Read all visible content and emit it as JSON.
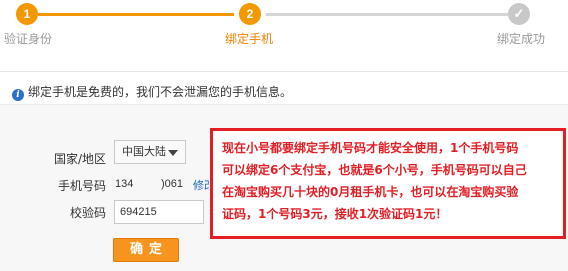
{
  "steps": [
    {
      "number": "1",
      "label": "验证身份",
      "state": "done"
    },
    {
      "number": "2",
      "label": "绑定手机",
      "state": "current"
    },
    {
      "number": "✓",
      "label": "绑定成功",
      "state": "pending"
    }
  ],
  "colors": {
    "accent": "#f39800",
    "link": "#1a66c2",
    "annotation": "#e31e24",
    "inactive": "#c8c8c8"
  },
  "notice": {
    "icon": "info-icon",
    "text": "绑定手机是免费的，我们不会泄漏您的手机信息。"
  },
  "form": {
    "country_label": "国家/地区",
    "country_value": "中国大陆",
    "phone_label": "手机号码",
    "phone_prefix": "134",
    "phone_suffix": ")061",
    "modify_link": "修改",
    "code_label": "校验码",
    "code_value": "694215",
    "confirm_button": "确定"
  },
  "annotation": {
    "lines": [
      "现在小号都要绑定手机号码才能安全使用，1个手机号码",
      "可以绑定6个支付宝，也就是6个小号，手机号码可以自己",
      "在淘宝购买几十块的0月租手机卡，也可以在淘宝购买验",
      "证码，1个号码3元，接收1次验证码1元！"
    ]
  }
}
